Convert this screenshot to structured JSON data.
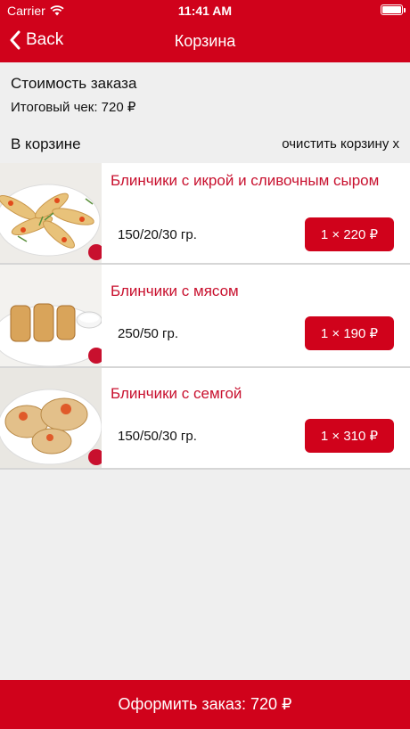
{
  "status_bar": {
    "carrier": "Carrier",
    "time": "11:41 AM"
  },
  "nav": {
    "back_label": "Back",
    "title": "Корзина"
  },
  "summary": {
    "title": "Стоимость заказа",
    "total": "Итоговый чек: 720 ₽"
  },
  "cart": {
    "label": "В корзине",
    "clear_label": "очистить корзину x"
  },
  "items": [
    {
      "name": "Блинчики с икрой и сливочным сыром",
      "weight": "150/20/30 гр.",
      "quantity_price": "1 × 220 ₽"
    },
    {
      "name": "Блинчики с мясом",
      "weight": "250/50 гр.",
      "quantity_price": "1 × 190 ₽"
    },
    {
      "name": "Блинчики с семгой",
      "weight": "150/50/30 гр.",
      "quantity_price": "1 × 310 ₽"
    }
  ],
  "checkout": {
    "label": "Оформить заказ: 720 ₽"
  },
  "colors": {
    "accent": "#d0021b",
    "item_name": "#c8102e",
    "background": "#efefef"
  }
}
